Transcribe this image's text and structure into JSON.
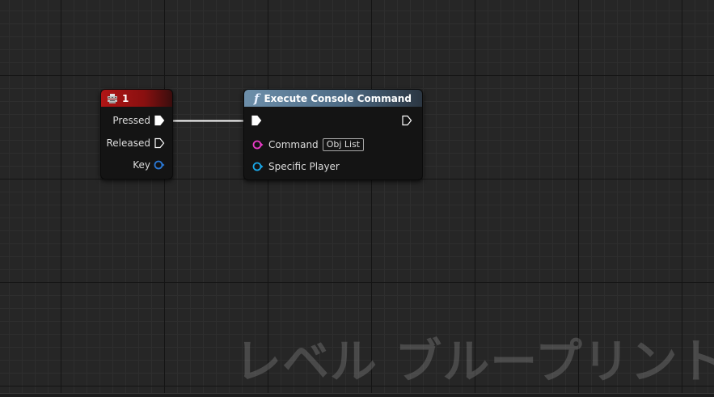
{
  "graph": {
    "watermark": "レベル ブループリント"
  },
  "key_node": {
    "title": "1",
    "header_color": "#b01515",
    "pins": {
      "pressed": "Pressed",
      "released": "Released",
      "key": "Key"
    }
  },
  "exec_node": {
    "title": "Execute Console Command",
    "func_glyph": "f",
    "header_color": "#6d8faa",
    "pins": {
      "command": "Command",
      "command_value": "Obj List",
      "specific_player": "Specific Player"
    }
  },
  "colors": {
    "exec_pin": "#ffffff",
    "string_pin": "#e83bc8",
    "struct_pin": "#2a78d6",
    "object_pin": "#19a7e8",
    "wire": "#ffffff"
  },
  "icons": {
    "key_node_icon": "keyboard-icon",
    "exec_node_icon": "function-icon"
  }
}
